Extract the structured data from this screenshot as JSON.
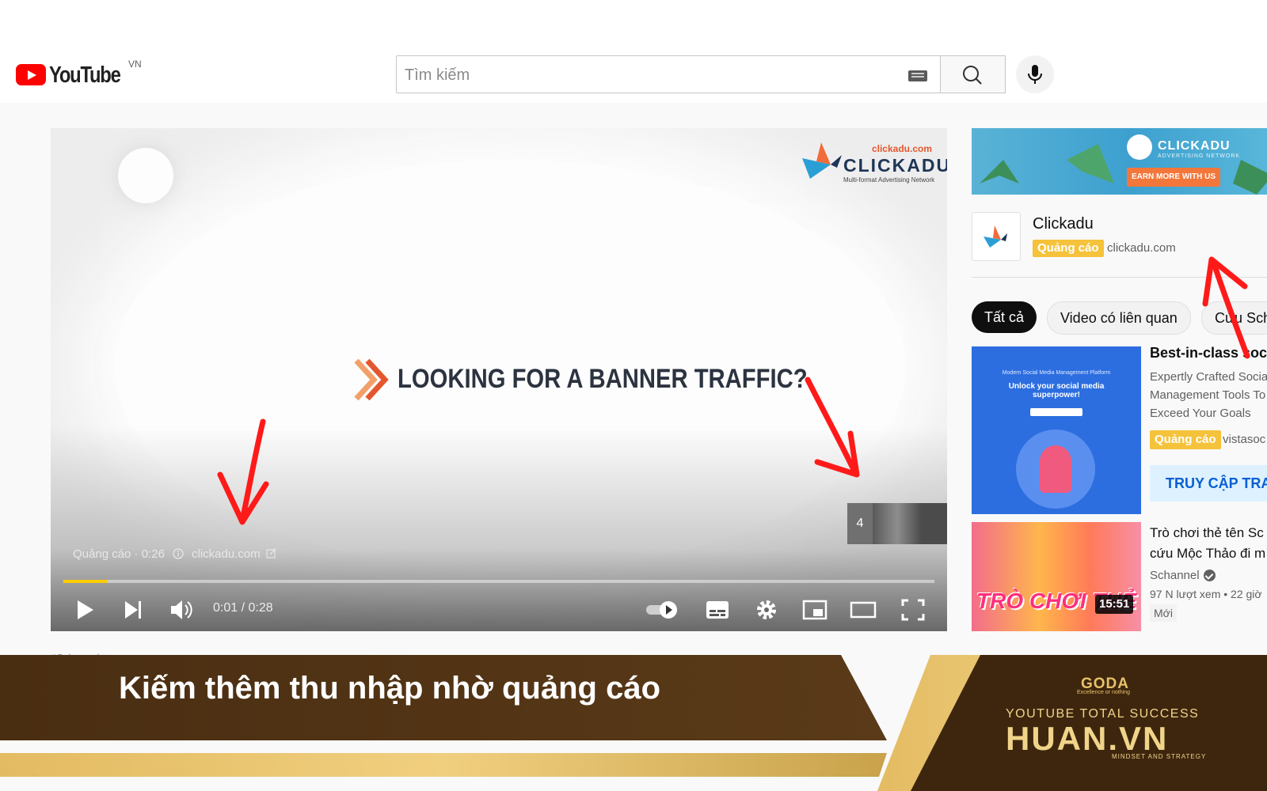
{
  "header": {
    "logo_text": "YouTube",
    "region": "VN",
    "search_placeholder": "Tìm kiếm"
  },
  "player": {
    "brand_url": "clickadu.com",
    "brand_name": "CLICKADU",
    "brand_tagline": "Multi-format Advertising Network",
    "headline": "LOOKING FOR A BANNER TRAFFIC?",
    "ad_label": "Quảng cáo · 0:26",
    "ad_url": "clickadu.com",
    "skip_count": "4",
    "time": "0:01 / 0:28",
    "progress_fraction": 0.05
  },
  "sidebar": {
    "banner_brand": "CLICKADU",
    "banner_sub": "ADVERTISING NETWORK",
    "banner_cta": "EARN MORE WITH US",
    "advertiser_name": "Clickadu",
    "ad_badge": "Quảng cáo",
    "advertiser_url": "clickadu.com",
    "chips": [
      "Tất cả",
      "Video có liên quan",
      "Cứu Sch"
    ],
    "rec1": {
      "thumb_line1": "Modern Social Media Management Platform",
      "thumb_line2": "Unlock your social media superpower!",
      "title": "Best-in-class socia",
      "desc": [
        "Expertly Crafted Socia",
        "Management Tools To",
        "Exceed Your Goals"
      ],
      "badge": "Quảng cáo",
      "channel": "vistasoc",
      "cta": "TRUY CẬP TRA"
    },
    "rec2": {
      "thumb_art": "TRÒ CHƠI THẺ",
      "duration": "15:51",
      "title_line1": "Trò chơi thẻ tên Sc",
      "title_line2": "cứu Mộc Thảo đi m",
      "channel": "Schannel",
      "meta": "97 N lượt xem • 22 giờ",
      "badge_new": "Mới"
    },
    "hashtag_cut": "#Schannel"
  },
  "footer": {
    "caption": "Kiếm thêm thu nhập nhờ quảng cáo",
    "logo_mark": "GODA",
    "logo_sub": "Excellence or nothing",
    "line1": "YOUTUBE TOTAL SUCCESS",
    "brand": "HUAN.VN",
    "slogan": "MINDSET AND STRATEGY"
  },
  "colors": {
    "youtube_red": "#ff0000",
    "ad_badge": "#f5c23b",
    "progress": "#ffcc00",
    "annotation_red": "#ff1a1a",
    "footer_brown": "#4a2e12",
    "footer_gold": "#c9a24b"
  }
}
